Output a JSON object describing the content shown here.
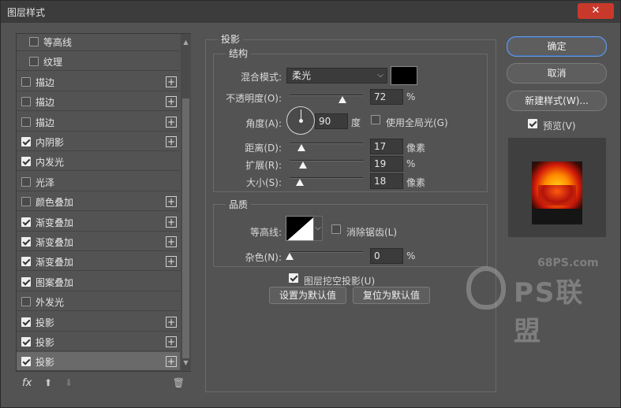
{
  "window": {
    "title": "图层样式",
    "close_label": "✕"
  },
  "style_list": [
    {
      "label": "等高线",
      "checked": false,
      "has_plus": false,
      "indent": true
    },
    {
      "label": "纹理",
      "checked": false,
      "has_plus": false,
      "indent": true
    },
    {
      "label": "描边",
      "checked": false,
      "has_plus": true
    },
    {
      "label": "描边",
      "checked": false,
      "has_plus": true
    },
    {
      "label": "描边",
      "checked": false,
      "has_plus": true
    },
    {
      "label": "内阴影",
      "checked": true,
      "has_plus": true
    },
    {
      "label": "内发光",
      "checked": true,
      "has_plus": false
    },
    {
      "label": "光泽",
      "checked": false,
      "has_plus": false
    },
    {
      "label": "颜色叠加",
      "checked": false,
      "has_plus": true
    },
    {
      "label": "渐变叠加",
      "checked": true,
      "has_plus": true
    },
    {
      "label": "渐变叠加",
      "checked": true,
      "has_plus": true
    },
    {
      "label": "渐变叠加",
      "checked": true,
      "has_plus": true
    },
    {
      "label": "图案叠加",
      "checked": true,
      "has_plus": false
    },
    {
      "label": "外发光",
      "checked": false,
      "has_plus": false
    },
    {
      "label": "投影",
      "checked": true,
      "has_plus": true
    },
    {
      "label": "投影",
      "checked": true,
      "has_plus": true
    },
    {
      "label": "投影",
      "checked": true,
      "has_plus": true,
      "selected": true
    }
  ],
  "list_footer": {
    "fx": "fx",
    "up": "⬆",
    "down": "⬇",
    "trash": "🗑"
  },
  "drop_shadow": {
    "section_title": "投影",
    "structure_title": "结构",
    "blend_mode_label": "混合模式:",
    "blend_mode_value": "柔光",
    "blend_color": "#000000",
    "opacity_label": "不透明度(O):",
    "opacity_value": "72",
    "opacity_unit": "%",
    "opacity_level": 0.72,
    "angle_label": "角度(A):",
    "angle_value": "90",
    "angle_unit": "度",
    "global_light_label": "使用全局光(G)",
    "global_light_checked": false,
    "distance_label": "距离(D):",
    "distance_value": "17",
    "distance_unit": "像素",
    "spread_label": "扩展(R):",
    "spread_value": "19",
    "spread_unit": "%",
    "size_label": "大小(S):",
    "size_value": "18",
    "size_unit": "像素",
    "quality_title": "品质",
    "contour_label": "等高线:",
    "antialias_label": "消除锯齿(L)",
    "antialias_checked": false,
    "noise_label": "杂色(N):",
    "noise_value": "0",
    "noise_unit": "%",
    "knockout_label": "图层挖空投影(U)",
    "knockout_checked": true,
    "set_default_label": "设置为默认值",
    "reset_default_label": "复位为默认值"
  },
  "actions": {
    "ok_label": "确定",
    "cancel_label": "取消",
    "new_style_label": "新建样式(W)...",
    "preview_label": "预览(V)",
    "preview_checked": true
  },
  "watermark": {
    "url": "68PS.com",
    "text": "PS联盟"
  },
  "colors": {
    "accent": "#6f9ad6",
    "close": "#c8392c"
  }
}
